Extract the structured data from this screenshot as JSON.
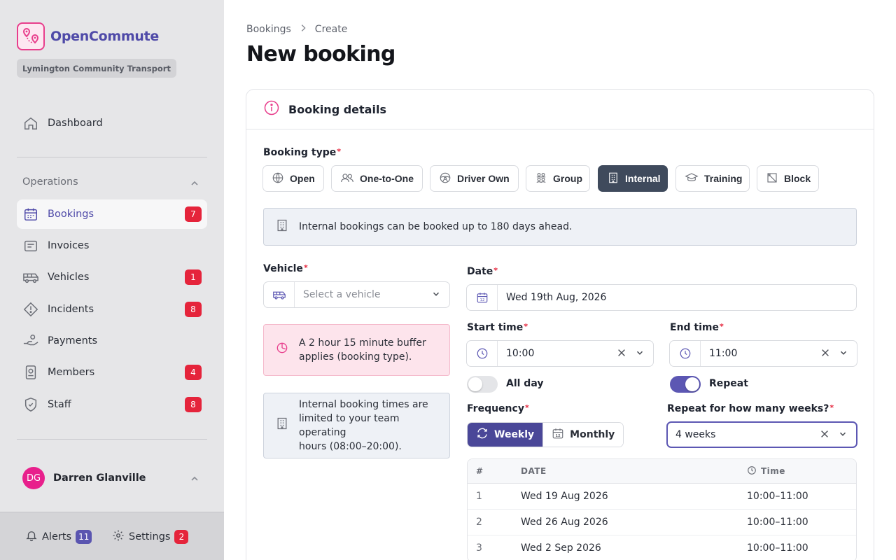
{
  "app": {
    "name": "OpenCommute",
    "organisation": "Lymington Community Transport"
  },
  "colors": {
    "brand": "#4f4aa8",
    "logo_pink": "#e83e8c",
    "badge_red": "#e5243b",
    "active_type": "#3f4a5c",
    "toggle_on": "#5c57b3"
  },
  "sidebar": {
    "dashboard": {
      "label": "Dashboard",
      "icon": "home-icon"
    },
    "section_title": "Operations",
    "items": [
      {
        "label": "Bookings",
        "icon": "calendar-icon",
        "badge": "7",
        "active": true
      },
      {
        "label": "Invoices",
        "icon": "receipt-icon",
        "badge": ""
      },
      {
        "label": "Vehicles",
        "icon": "bus-icon",
        "badge": "1"
      },
      {
        "label": "Incidents",
        "icon": "warning-icon",
        "badge": "8"
      },
      {
        "label": "Payments",
        "icon": "hand-coins-icon",
        "badge": ""
      },
      {
        "label": "Members",
        "icon": "id-card-icon",
        "badge": "4"
      },
      {
        "label": "Staff",
        "icon": "shield-icon",
        "badge": "8"
      }
    ],
    "user": {
      "initials": "DG",
      "name": "Darren Glanville"
    },
    "footer": {
      "alerts_label": "Alerts",
      "alerts_count": "11",
      "settings_label": "Settings",
      "settings_count": "2"
    }
  },
  "breadcrumb": {
    "parent": "Bookings",
    "current": "Create"
  },
  "page_title": "New booking",
  "card": {
    "title": "Booking details"
  },
  "booking_type": {
    "label": "Booking type",
    "options": [
      {
        "label": "Open",
        "icon": "globe-icon"
      },
      {
        "label": "One-to-One",
        "icon": "users-icon"
      },
      {
        "label": "Driver Own",
        "icon": "steering-wheel-icon"
      },
      {
        "label": "Group",
        "icon": "group-icon"
      },
      {
        "label": "Internal",
        "icon": "building-icon",
        "selected": true
      },
      {
        "label": "Training",
        "icon": "graduation-cap-icon"
      },
      {
        "label": "Block",
        "icon": "block-icon"
      }
    ]
  },
  "info_banner": "Internal bookings can be booked up to 180 days ahead.",
  "vehicle": {
    "label": "Vehicle",
    "placeholder": "Select a vehicle"
  },
  "buffer_alert": {
    "line1": "A 2 hour 15 minute buffer",
    "line2": "applies (booking type)."
  },
  "hours_alert": {
    "line1": "Internal booking times are",
    "line2": "limited to your team operating",
    "line3": "hours (08:00–20:00)."
  },
  "date": {
    "label": "Date",
    "value": "Wed 19th Aug, 2026"
  },
  "start_time": {
    "label": "Start time",
    "value": "10:00"
  },
  "end_time": {
    "label": "End time",
    "value": "11:00"
  },
  "all_day": {
    "label": "All day",
    "on": false
  },
  "repeat": {
    "label": "Repeat",
    "on": true
  },
  "frequency": {
    "label": "Frequency",
    "options": [
      {
        "label": "Weekly",
        "selected": true
      },
      {
        "label": "Monthly"
      }
    ]
  },
  "repeat_weeks": {
    "label": "Repeat for how many weeks?",
    "value": "4 weeks"
  },
  "schedule": {
    "headers": {
      "num": "#",
      "date": "DATE",
      "time": "Time"
    },
    "rows": [
      {
        "num": "1",
        "date": "Wed 19 Aug 2026",
        "time": "10:00–11:00"
      },
      {
        "num": "2",
        "date": "Wed 26 Aug 2026",
        "time": "10:00–11:00"
      },
      {
        "num": "3",
        "date": "Wed 2 Sep 2026",
        "time": "10:00–11:00"
      }
    ]
  }
}
